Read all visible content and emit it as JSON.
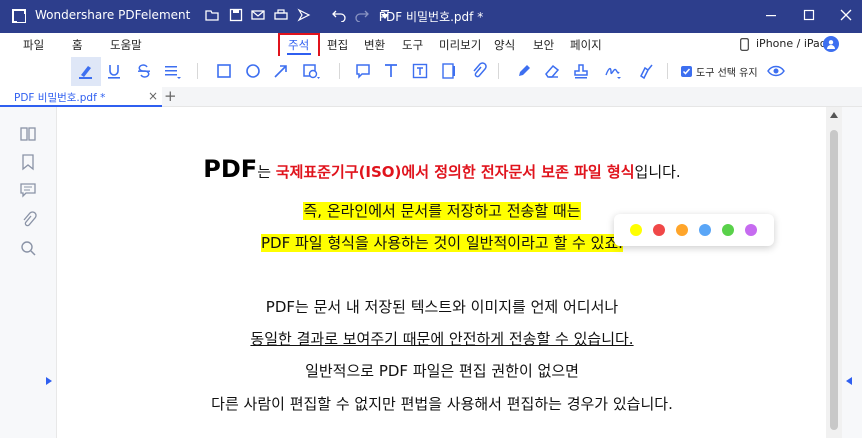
{
  "app": {
    "name": "Wondershare PDFelement",
    "doc_title": "PDF 비밀번호.pdf *"
  },
  "menu": {
    "items": [
      "파일",
      "홈",
      "도움말",
      "주석",
      "편집",
      "변환",
      "도구",
      "미리보기",
      "양식",
      "보안",
      "페이지"
    ],
    "active": "주석",
    "device_link": "iPhone / iPad"
  },
  "toolbar": {
    "keep_tool_label": "도구 선택 유지"
  },
  "tab": {
    "label": "PDF 비밀번호.pdf *",
    "close": "×",
    "add": "+"
  },
  "document": {
    "line1_big": "PDF",
    "line1_mid": "는 ",
    "line1_red": "국제표준기구(ISO)에서 정의한 전자문서 보존 파일 형식",
    "line1_end": "입니다.",
    "line2": "즉, 온라인에서 문서를 저장하고 전송할 때는",
    "line3": "PDF 파일 형식을 사용하는 것이 일반적이라고 할 수 있죠.",
    "line4": "PDF는 문서 내 저장된 텍스트와 이미지를 언제 어디서나",
    "line5": "동일한 결과로 보여주기 때문에 안전하게 전송할 수 있습니다.",
    "line6": "일반적으로 PDF 파일은 편집 권한이 없으면",
    "line7": "다른 사람이 편집할 수 없지만 편법을 사용해서 편집하는 경우가 있습니다."
  },
  "palette": {
    "colors": [
      "#ffff00",
      "#f04848",
      "#ffa52a",
      "#5aa6f7",
      "#59d14a",
      "#c66bf0"
    ]
  },
  "colors": {
    "titlebar": "#2d3e8c",
    "accent": "#2f5ff0",
    "highlight": "#ffff00",
    "emphasis": "#e0131c"
  }
}
